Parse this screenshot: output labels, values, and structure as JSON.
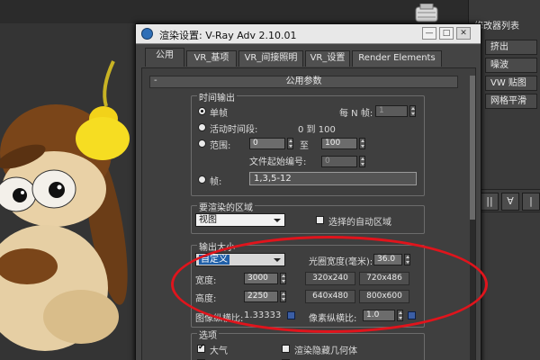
{
  "dialog": {
    "title": "渲染设置: V-Ray Adv 2.10.01",
    "window_buttons": {
      "minimize": "—",
      "maximize": "□",
      "close": "✕"
    },
    "tabs": [
      "公用",
      "VR_基项",
      "VR_间接照明",
      "VR_设置",
      "Render Elements"
    ],
    "rollout": {
      "toggle": "-",
      "title": "公用参数"
    }
  },
  "time_output": {
    "title": "时间输出",
    "single": "单帧",
    "every_n_label": "每 N 帧:",
    "every_n_value": "1",
    "active_segment": "活动时间段:",
    "active_range": "0 到 100",
    "range": "范围:",
    "range_from": "0",
    "range_to_label": "至",
    "range_to": "100",
    "file_start_label": "文件起始编号:",
    "file_start_value": "0",
    "frames": "帧:",
    "frames_value": "1,3,5-12"
  },
  "render_area": {
    "title": "要渲染的区域",
    "mode": "视图",
    "auto_region": "选择的自动区域"
  },
  "output_size": {
    "title": "输出大小",
    "preset": "自定义",
    "aperture_label": "光圈宽度(毫米):",
    "aperture_value": "36.0",
    "width_label": "宽度:",
    "width_value": "3000",
    "height_label": "高度:",
    "height_value": "2250",
    "presets": [
      "320x240",
      "720x486",
      "640x480",
      "800x600"
    ],
    "image_aspect_label": "图像纵横比:",
    "image_aspect_value": "1.33333",
    "pixel_aspect_label": "像素纵横比:",
    "pixel_aspect_value": "1.0"
  },
  "options": {
    "title": "选项",
    "atmosphere": "大气",
    "render_hidden": "渲染隐藏几何体"
  },
  "right_panel": {
    "title": "修改器列表",
    "buttons": [
      "挤出",
      "噪波",
      "VW 贴图",
      "网格平滑"
    ]
  },
  "toolstrip": [
    "||",
    "∀",
    "|"
  ],
  "colors": {
    "highlight_ellipse": "#e0141c",
    "dialog_bg": "#444444",
    "selection_blue": "#1f5fa8"
  }
}
